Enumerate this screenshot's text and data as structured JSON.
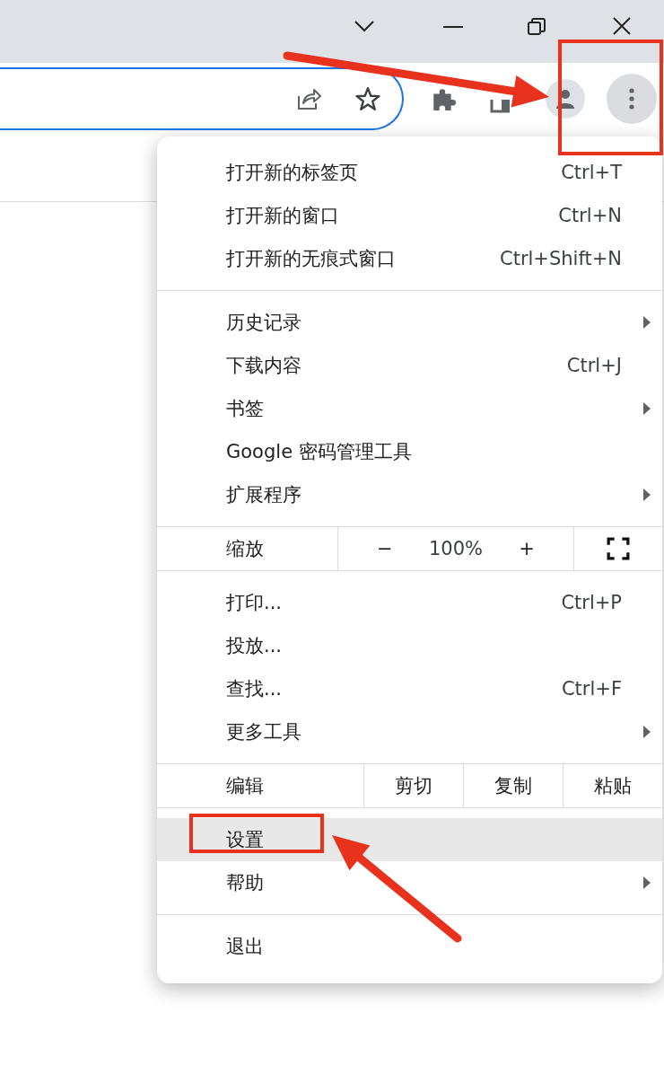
{
  "menu": {
    "sections": [
      {
        "kind": "items",
        "items": [
          {
            "label": "打开新的标签页",
            "shortcut": "Ctrl+T",
            "submenu": false,
            "selected": false
          },
          {
            "label": "打开新的窗口",
            "shortcut": "Ctrl+N",
            "submenu": false,
            "selected": false
          },
          {
            "label": "打开新的无痕式窗口",
            "shortcut": "Ctrl+Shift+N",
            "submenu": false,
            "selected": false
          }
        ]
      },
      {
        "kind": "items",
        "items": [
          {
            "label": "历史记录",
            "submenu": true,
            "selected": false
          },
          {
            "label": "下载内容",
            "shortcut": "Ctrl+J",
            "submenu": false,
            "selected": false
          },
          {
            "label": "书签",
            "submenu": true,
            "selected": false
          },
          {
            "label": "Google 密码管理工具",
            "submenu": false,
            "selected": false
          },
          {
            "label": "扩展程序",
            "submenu": true,
            "selected": false
          }
        ]
      },
      {
        "kind": "zoom",
        "label": "缩放",
        "minus": "−",
        "value": "100%",
        "plus": "+"
      },
      {
        "kind": "items",
        "items": [
          {
            "label": "打印...",
            "shortcut": "Ctrl+P",
            "submenu": false,
            "selected": false
          },
          {
            "label": "投放...",
            "submenu": false,
            "selected": false
          },
          {
            "label": "查找...",
            "shortcut": "Ctrl+F",
            "submenu": false,
            "selected": false
          },
          {
            "label": "更多工具",
            "submenu": true,
            "selected": false
          }
        ]
      },
      {
        "kind": "edit",
        "label": "编辑",
        "buttons": [
          "剪切",
          "复制",
          "粘贴"
        ]
      },
      {
        "kind": "items",
        "items": [
          {
            "label": "设置",
            "submenu": false,
            "selected": true
          },
          {
            "label": "帮助",
            "submenu": true,
            "selected": false
          }
        ]
      },
      {
        "kind": "items",
        "items": [
          {
            "label": "退出",
            "submenu": false,
            "selected": false
          }
        ]
      }
    ]
  }
}
